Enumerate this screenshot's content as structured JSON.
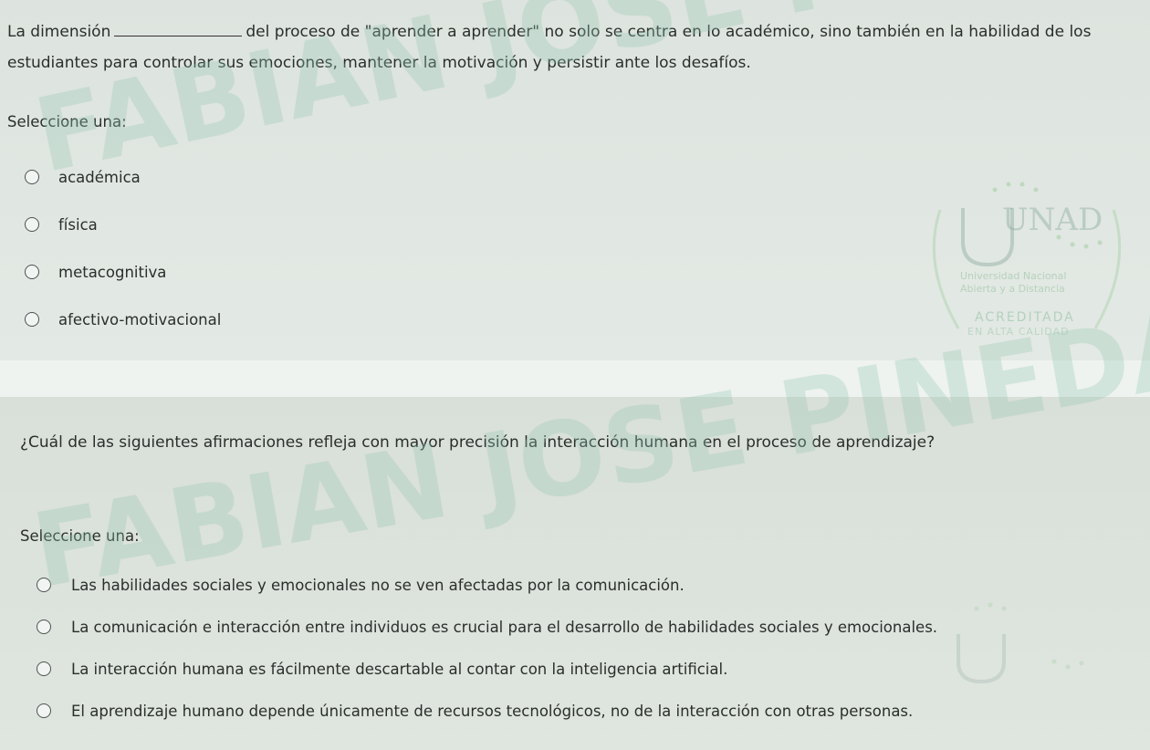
{
  "question1": {
    "text_before_blank": "La dimensión",
    "text_after_blank": "del proceso de \"aprender a aprender\" no solo se centra en lo académico, sino también en la habilidad de los estudiantes para controlar sus emociones, mantener la motivación y persistir ante los desafíos.",
    "select_label": "Seleccione una:",
    "options": [
      "académica",
      "física",
      "metacognitiva",
      "afectivo-motivacional"
    ]
  },
  "question2": {
    "text": "¿Cuál de las siguientes afirmaciones refleja con mayor precisión la interacción humana en el proceso de aprendizaje?",
    "select_label": "Seleccione una:",
    "options": [
      "Las habilidades sociales y emocionales no se ven afectadas por la comunicación.",
      "La comunicación e interacción entre individuos es crucial para el desarrollo de habilidades sociales y emocionales.",
      "La interacción humana es fácilmente descartable al contar con la inteligencia artificial.",
      "El aprendizaje humano depende únicamente de recursos tecnológicos, no de la interacción con otras personas."
    ]
  },
  "watermark": {
    "text": "FABIAN JOSE PINEDA GIL",
    "logo_text": "UNAD",
    "logo_line1": "Universidad Nacional",
    "logo_line2": "Abierta y a Distancia",
    "logo_badge": "ACREDITADA",
    "logo_badge2": "EN ALTA CALIDAD"
  },
  "colors": {
    "background": "#e2e8e3",
    "watermark": "#96c8b4",
    "text": "#2a2f2c"
  }
}
